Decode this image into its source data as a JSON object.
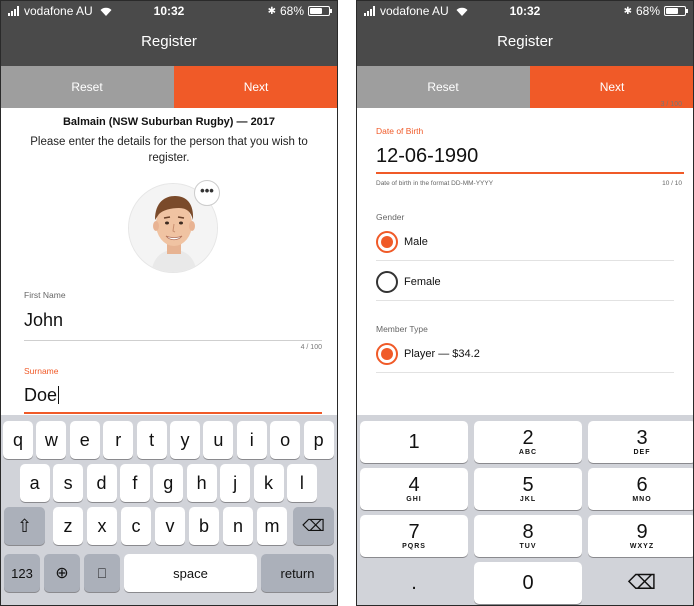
{
  "status": {
    "carrier": "vodafone AU",
    "time": "10:32",
    "bluetooth": "✱",
    "battery": "68%",
    "battery_level": 0.68
  },
  "nav": {
    "title": "Register",
    "reset_label": "Reset",
    "next_label": "Next"
  },
  "screen1": {
    "org_title": "Balmain (NSW Suburban Rugby) — 2017",
    "intro": "Please enter the details for the person that you wish to register.",
    "more_label": "•••",
    "first_name": {
      "label": "First Name",
      "value": "John",
      "counter": "4 / 100"
    },
    "surname": {
      "label": "Surname",
      "value": "Doe"
    }
  },
  "keyboard": {
    "row1": [
      "q",
      "w",
      "e",
      "r",
      "t",
      "y",
      "u",
      "i",
      "o",
      "p"
    ],
    "row2": [
      "a",
      "s",
      "d",
      "f",
      "g",
      "h",
      "j",
      "k",
      "l"
    ],
    "row3": [
      "z",
      "x",
      "c",
      "v",
      "b",
      "n",
      "m"
    ],
    "shift": "⇧",
    "backspace": "⌫",
    "numbers": "123",
    "globe": "⊕",
    "mic": "⎕",
    "space": "space",
    "return": "return"
  },
  "screen2": {
    "prev_counter": "3 / 100",
    "dob": {
      "label": "Date of Birth",
      "value": "12-06-1990",
      "hint": "Date of birth in the format DD-MM-YYYY",
      "counter": "10 / 10"
    },
    "gender": {
      "label": "Gender",
      "options": [
        "Male",
        "Female"
      ],
      "selected": "Male"
    },
    "member_type": {
      "label": "Member Type",
      "options": [
        "Player — $34.2"
      ],
      "selected": "Player — $34.2"
    }
  },
  "numpad": {
    "keys": [
      {
        "digit": "1",
        "letters": ""
      },
      {
        "digit": "2",
        "letters": "ABC"
      },
      {
        "digit": "3",
        "letters": "DEF"
      },
      {
        "digit": "4",
        "letters": "GHI"
      },
      {
        "digit": "5",
        "letters": "JKL"
      },
      {
        "digit": "6",
        "letters": "MNO"
      },
      {
        "digit": "7",
        "letters": "PQRS"
      },
      {
        "digit": "8",
        "letters": "TUV"
      },
      {
        "digit": "9",
        "letters": "WXYZ"
      },
      {
        "digit": ".",
        "letters": ""
      },
      {
        "digit": "0",
        "letters": ""
      },
      {
        "digit": "⌫",
        "letters": ""
      }
    ]
  },
  "colors": {
    "accent": "#f05a28",
    "bar": "#4a4a4a",
    "reset": "#9e9e9e"
  }
}
